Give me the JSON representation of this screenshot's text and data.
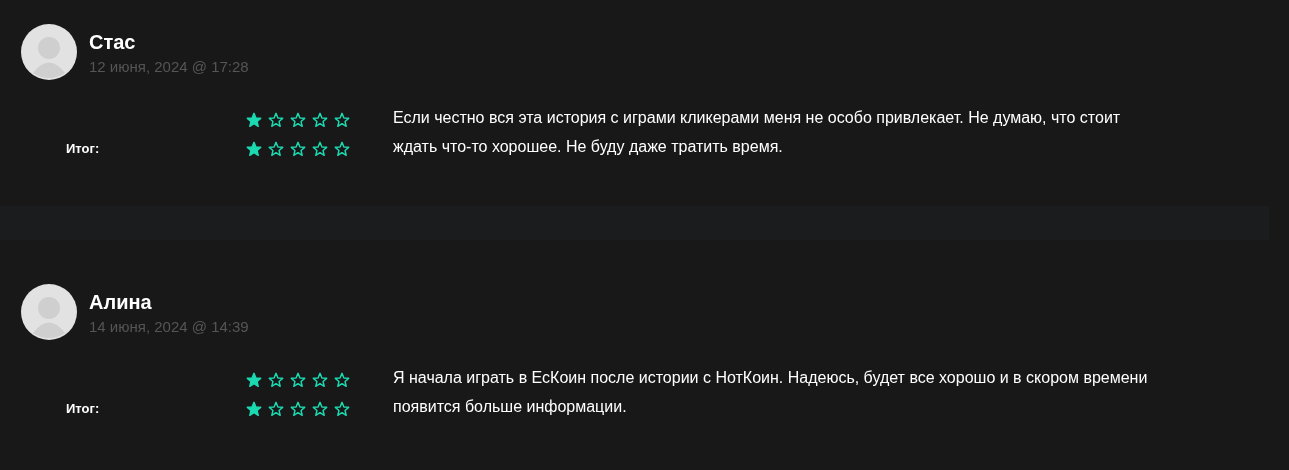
{
  "reviews": [
    {
      "name": "Стас",
      "date": "12 июня, 2024 @ 17:28",
      "ratings": [
        {
          "stars": 1
        },
        {
          "label": "Итог:",
          "stars": 1
        }
      ],
      "text": "Если честно вся эта история с играми кликерами меня не особо привлекает. Не думаю, что стоит ждать что-то хорошее. Не буду даже тратить время."
    },
    {
      "name": "Алина",
      "date": "14 июня, 2024 @ 14:39",
      "ratings": [
        {
          "stars": 1
        },
        {
          "label": "Итог:",
          "stars": 1
        }
      ],
      "text": "Я начала играть в ЕсКоин после истории с НотКоин. Надеюсь, будет все хорошо и в скором времени появится больше информации."
    }
  ]
}
